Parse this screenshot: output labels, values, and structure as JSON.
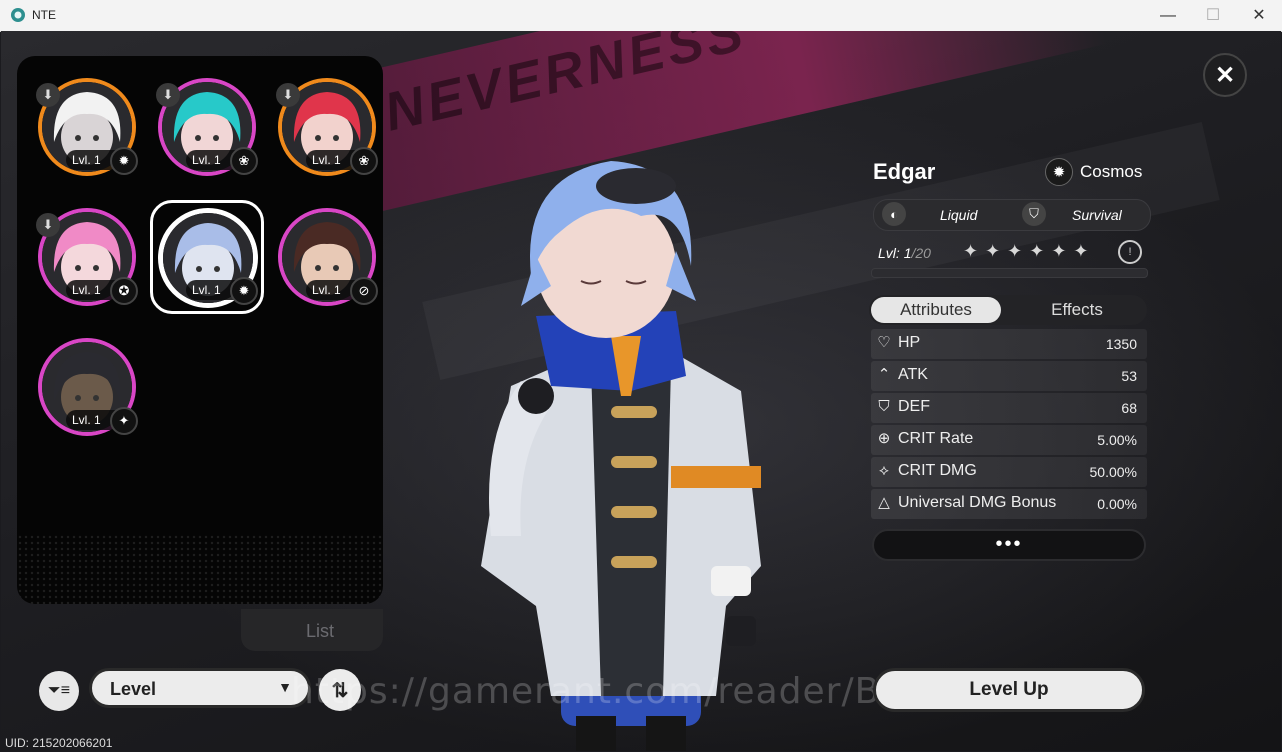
{
  "window": {
    "title": "NTE",
    "minimize": "—",
    "maximize": "☐",
    "close": "✕"
  },
  "background": {
    "banner_text": "NEVERNESS"
  },
  "roster": {
    "characters": [
      {
        "level": "Lvl. 1",
        "element_icon": "cosmos-icon",
        "element_glyph": "✹",
        "ring_color": "#f08a1c",
        "face_color": "#d9d4d6",
        "hair_color": "#f2f2f2",
        "has_download": true
      },
      {
        "level": "Lvl. 1",
        "element_icon": "anima-icon",
        "element_glyph": "❀",
        "ring_color": "#d946c6",
        "face_color": "#f1d6d6",
        "hair_color": "#27c9c9",
        "has_download": true
      },
      {
        "level": "Lvl. 1",
        "element_icon": "anima-icon",
        "element_glyph": "❀",
        "ring_color": "#f08a1c",
        "face_color": "#f2d2cd",
        "hair_color": "#e0354b",
        "has_download": true
      },
      {
        "level": "Lvl. 1",
        "element_icon": "psyche-icon",
        "element_glyph": "✪",
        "ring_color": "#d946c6",
        "face_color": "#f4d8dc",
        "hair_color": "#f08ac6",
        "has_download": true
      },
      {
        "level": "Lvl. 1",
        "element_icon": "cosmos-icon",
        "element_glyph": "✹",
        "ring_color": "#ffffff",
        "face_color": "#dfe4f0",
        "hair_color": "#a9bde8",
        "has_download": false
      },
      {
        "level": "Lvl. 1",
        "element_icon": "incantation-icon",
        "element_glyph": "⊘",
        "ring_color": "#d946c6",
        "face_color": "#e8c9b6",
        "hair_color": "#4a2a24",
        "has_download": false
      },
      {
        "level": "Lvl. 1",
        "element_icon": "chaos-icon",
        "element_glyph": "✦",
        "ring_color": "#d946c6",
        "face_color": "#6b5a4a",
        "hair_color": "#2a2a30",
        "has_download": false
      }
    ],
    "list_tab": "List"
  },
  "controls": {
    "sort_label": "Level",
    "uid": "UID: 215202066201"
  },
  "character": {
    "name": "Edgar",
    "faction": "Cosmos",
    "tag1": "Liquid",
    "tag2": "Survival",
    "level_prefix": "Lvl: ",
    "level_current": "1",
    "level_max": "/20",
    "stars": "✦✦✦✦✦✦",
    "exp_fraction": 0.0
  },
  "stats": {
    "tab_active": "Attributes",
    "tab_inactive": "Effects",
    "rows": [
      {
        "icon": "heart-icon",
        "glyph": "♡",
        "label": "HP",
        "value": "1350"
      },
      {
        "icon": "atk-icon",
        "glyph": "⌃",
        "label": "ATK",
        "value": "53"
      },
      {
        "icon": "def-icon",
        "glyph": "⛉",
        "label": "DEF",
        "value": "68"
      },
      {
        "icon": "crit-rate-icon",
        "glyph": "⊕",
        "label": "CRIT Rate",
        "value": "5.00%"
      },
      {
        "icon": "crit-dmg-icon",
        "glyph": "⟡",
        "label": "CRIT DMG",
        "value": "50.00%"
      },
      {
        "icon": "dmg-bonus-icon",
        "glyph": "△",
        "label": "Universal DMG Bonus",
        "value": "0.00%"
      }
    ],
    "more": "•••"
  },
  "actions": {
    "level_up": "Level Up"
  },
  "watermark": "https://gamerant.com/reader/BangJohn"
}
